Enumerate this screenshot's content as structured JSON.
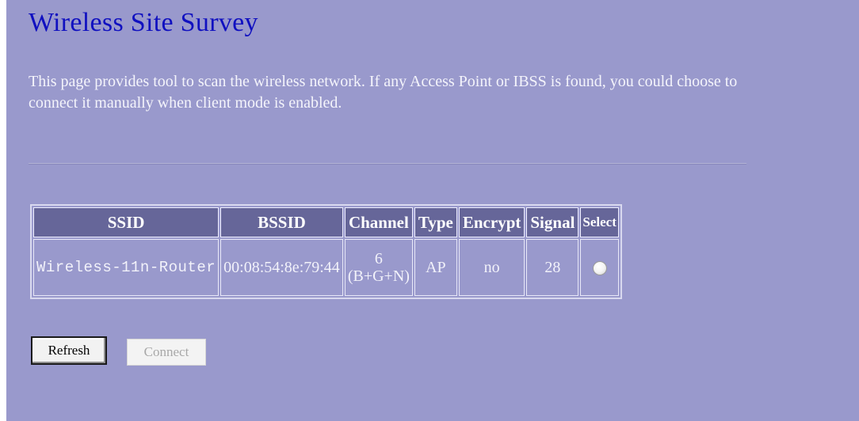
{
  "page": {
    "title": "Wireless Site Survey",
    "description": "This page provides tool to scan the wireless network. If any Access Point or IBSS is found, you could choose to connect it manually when client mode is enabled."
  },
  "table": {
    "headers": {
      "ssid": "SSID",
      "bssid": "BSSID",
      "channel": "Channel",
      "type": "Type",
      "encrypt": "Encrypt",
      "signal": "Signal",
      "select": "Select"
    },
    "rows": [
      {
        "ssid": "Wireless-11n-Router",
        "bssid": "00:08:54:8e:79:44",
        "channel_number": "6",
        "channel_mode": "(B+G+N)",
        "type": "AP",
        "encrypt": "no",
        "signal": "28",
        "selected": false
      }
    ]
  },
  "buttons": {
    "refresh": "Refresh",
    "connect": "Connect"
  },
  "colors": {
    "background": "#9999cc",
    "title": "#1010c0",
    "header_bg": "#666699"
  }
}
